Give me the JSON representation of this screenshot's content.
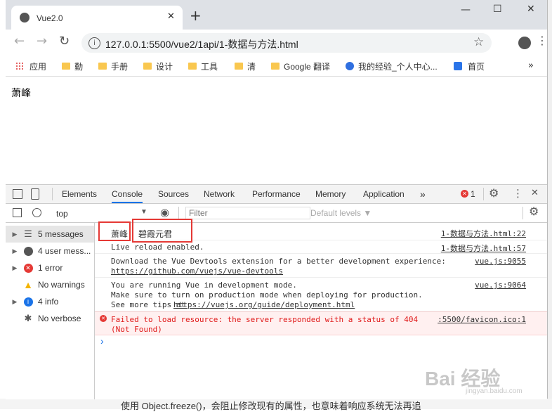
{
  "browser": {
    "tab_title": "Vue2.0",
    "url": "127.0.0.1:5500/vue2/1api/1-数据与方法.html",
    "new_tab": "+",
    "close_tab": "✕",
    "bookmarks": [
      "应用",
      "勤",
      "手册",
      "设计",
      "工具",
      "清",
      "Google 翻译",
      "我的经验_个人中心...",
      "首页"
    ]
  },
  "page": {
    "body_text": "萧峰"
  },
  "devtools": {
    "tabs": [
      "Elements",
      "Console",
      "Sources",
      "Network",
      "Performance",
      "Memory",
      "Application"
    ],
    "active_tab": "Console",
    "more_tabs": "»",
    "error_count": "1",
    "context": "top",
    "filter_placeholder": "Filter",
    "levels": "Default levels ▼",
    "sidebar": [
      {
        "label": "5 messages"
      },
      {
        "label": "4 user mess..."
      },
      {
        "label": "1 error"
      },
      {
        "label": "No warnings"
      },
      {
        "label": "4 info"
      },
      {
        "label": "No verbose"
      }
    ],
    "messages": [
      {
        "text1": "萧峰",
        "text2": "碧霞元君",
        "source": "1-数据与方法.html:22"
      },
      {
        "text": "Live reload enabled.",
        "source": "1-数据与方法.html:57"
      },
      {
        "line1": "Download the Vue Devtools extension for a better development experience:",
        "line2": "https://github.com/vuejs/vue-devtools",
        "source": "vue.js:9055"
      },
      {
        "line1": "You are running Vue in development mode.",
        "line2": "Make sure to turn on production mode when deploying for production.",
        "line3_prefix": "See more tips at ",
        "line3_link": "https://vuejs.org/guide/deployment.html",
        "source": "vue.js:9064"
      },
      {
        "line1": "Failed to load resource: the server responded with a status of 404",
        "line2": "(Not Found)",
        "source": ":5500/favicon.ico:1"
      }
    ],
    "prompt": "›"
  },
  "watermark": {
    "brand": "Bai 经验",
    "sub": "jingyan.baidu.com"
  },
  "background_text": "使用 Object.freeze()，会阻止修改现有的属性，也意味着响应系统无法再追"
}
